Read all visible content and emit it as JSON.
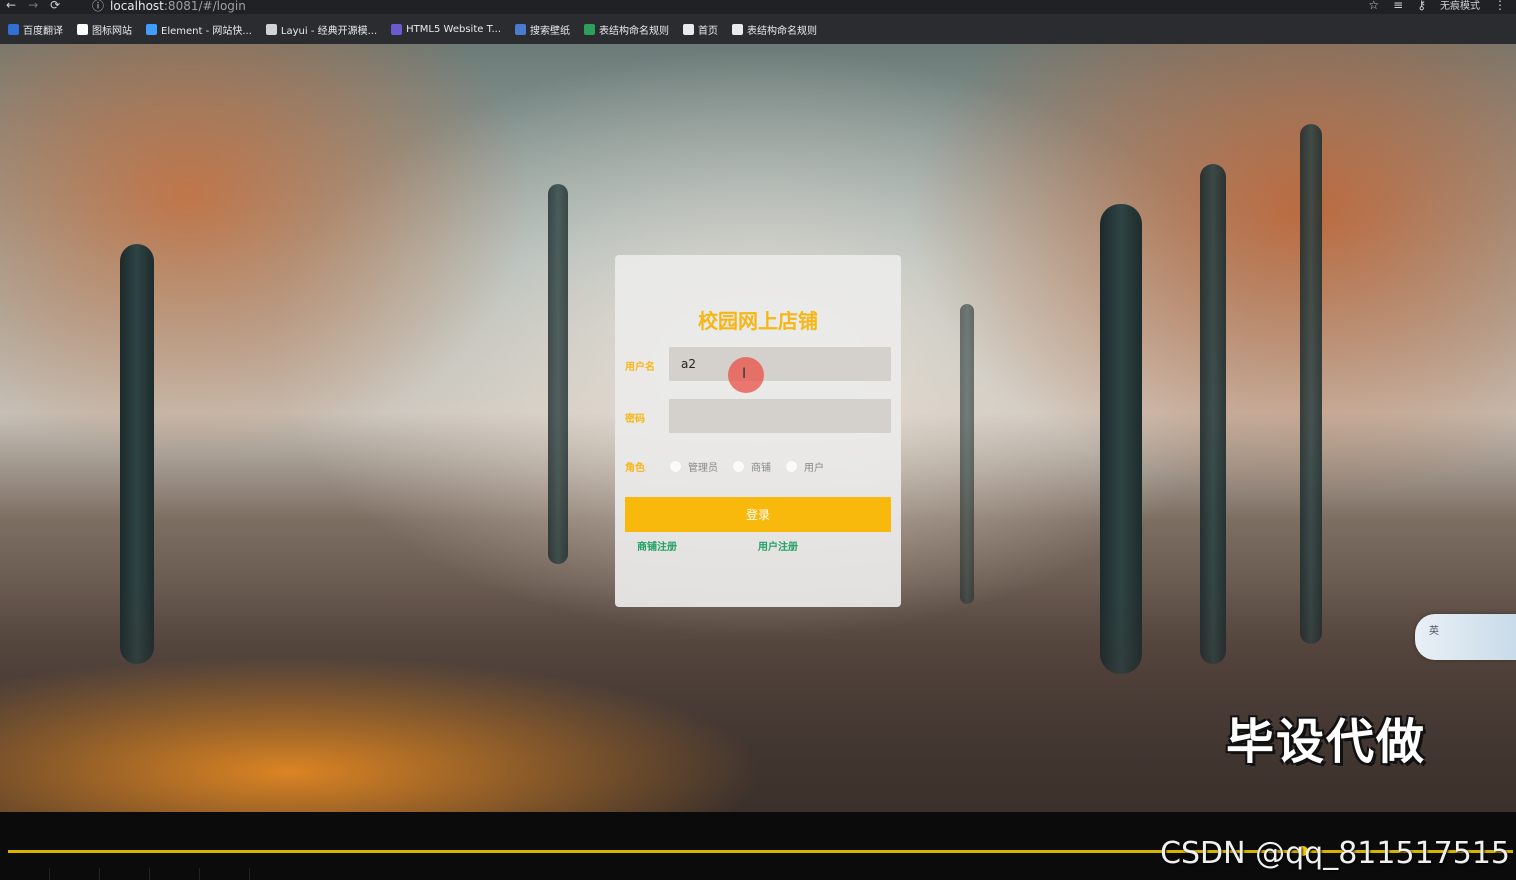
{
  "browser": {
    "url_host": "localhost",
    "url_path": ":8081/#/login",
    "incognito_label": "无痕模式",
    "bookmarks": [
      {
        "label": "百度翻译",
        "color": "#2f6fd6"
      },
      {
        "label": "图标网站",
        "color": "#ffffff"
      },
      {
        "label": "Element - 网站快...",
        "color": "#409eff"
      },
      {
        "label": "Layui - 经典开源模...",
        "color": "#cfd3d8"
      },
      {
        "label": "HTML5 Website T...",
        "color": "#6a5acd"
      },
      {
        "label": "搜索壁纸",
        "color": "#4a7bd0"
      },
      {
        "label": "表结构命名规则",
        "color": "#2e9e5b"
      },
      {
        "label": "首页",
        "color": "#e8eaed"
      },
      {
        "label": "表结构命名规则",
        "color": "#e8eaed"
      }
    ]
  },
  "login": {
    "title": "校园网上店铺",
    "username_label": "用户名",
    "username_value": "a2",
    "password_label": "密码",
    "role_label": "角色",
    "roles": [
      "管理员",
      "商铺",
      "用户"
    ],
    "submit_label": "登录",
    "link_shop_register": "商铺注册",
    "link_user_register": "用户注册"
  },
  "widget": {
    "text": "英"
  },
  "watermark": "毕设代做",
  "player": {
    "credit": "CSDN @qq_811517515",
    "progress_fraction": 0.86
  }
}
